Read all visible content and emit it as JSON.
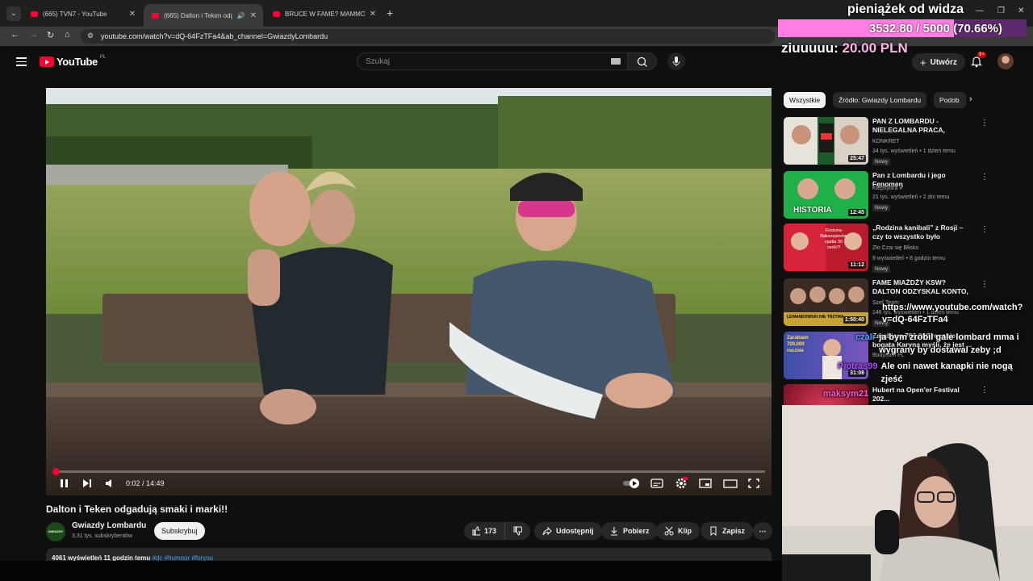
{
  "browser": {
    "tabs": [
      {
        "title": "(665) TVN7 - YouTube",
        "active": false
      },
      {
        "title": "(665) Dalton i Teken odgadu",
        "active": true
      },
      {
        "title": "BRUCE W FAME? MAMMON V",
        "active": false
      }
    ],
    "url": "youtube.com/watch?v=dQ-64FzTFa4&ab_channel=GwiazdyLombardu"
  },
  "youtube": {
    "logo_text": "YouTube",
    "region": "PL",
    "search_placeholder": "Szukaj",
    "create_label": "Utwórz",
    "notif_count": "9+"
  },
  "overlay": {
    "title": "pieniążek od widza",
    "goal_text": "3532.80 / 5000 (70.66%)",
    "goal_progress": 0.7066,
    "goal_color": "#ff7ee3",
    "donor_name": "ziuuuuu:",
    "donor_amount": "20.00 PLN"
  },
  "player": {
    "time": "0:02 / 14:49",
    "progress": 0.0023
  },
  "video": {
    "title": "Dalton i Teken odgadują smaki i marki!!",
    "channel": "Gwiazdy Lombardu",
    "channel_badge": "GWIAZDY LOMBARDU",
    "subs": "3,31 tys. subskrybentów",
    "subscribe": "Subskrybuj",
    "likes": "173",
    "share": "Udostępnij",
    "download": "Pobierz",
    "clip": "Klip",
    "save": "Zapisz",
    "desc_meta": "4061 wyświetleń  11 godzin temu",
    "desc_tags": "#dc #humour #foryou"
  },
  "sidebar": {
    "chips": [
      "Wszystkie",
      "Źródło: Gwiazdy Lombardu",
      "Podob"
    ],
    "recs": [
      {
        "title": "PAN Z LOMBARDU - NIELEGALNA PRACA, ZAROB...",
        "channel": "KONKRET",
        "meta": "34 tys. wyświetleń • 1 dzień temu",
        "badge": "Nowy",
        "duration": "25:47",
        "thumb_text": ""
      },
      {
        "title": "Pan z Lombardu i jego Fenomen",
        "channel": "Klepsydra ✔",
        "meta": "21 tys. wyświetleń • 2 dni temu",
        "badge": "Nowy",
        "duration": "12:45",
        "thumb_text": "HISTORIA"
      },
      {
        "title": "„Rodzina kanibali” z Rosji – czy to wszystko było kłamstwem? ...",
        "channel": "Zło Czai się Blisko",
        "meta": "9 wyświetleń • 8 godzin temu",
        "badge": "Nowy",
        "duration": "11:12",
        "thumb_text": "Rodzina Bakszejewów zjadła 30 osób?!"
      },
      {
        "title": "FAME MIAŻDŻY KSW? DALTON ODZYSKAL KONTO, RAPERZY ...",
        "channel": "Szef Team",
        "meta": "146 tys. wyświetleń • 1 dzień temu",
        "badge": "Nowy",
        "duration": "1:50:40",
        "thumb_text": "LEWANDOWSKI NIE TRZYMA"
      },
      {
        "title": "Zarabiam 700,000 rocznie - bogata Karyna myśli, że jest ...",
        "channel": "Bodycam PL",
        "meta": "",
        "badge": "",
        "duration": "31:08",
        "thumb_text": "Zarabiam 700,000 rocznie"
      },
      {
        "title": "Hubert na Open'er Festival 202...",
        "channel": "",
        "meta": "",
        "badge": "",
        "duration": "",
        "thumb_text": ""
      }
    ]
  },
  "chat": [
    {
      "user": "",
      "text": "https://www.youtube.com/watch?v=dQ-64FzTFa4"
    },
    {
      "user": "czalr",
      "text": "ja bym zrobil gale lombard mma i wygrany by dostawal zeby ;d"
    },
    {
      "user": "Piotras99",
      "text": "Ale oni nawet kanapki nie nogą zjeść"
    },
    {
      "user": "maksym21",
      "text": ""
    }
  ]
}
